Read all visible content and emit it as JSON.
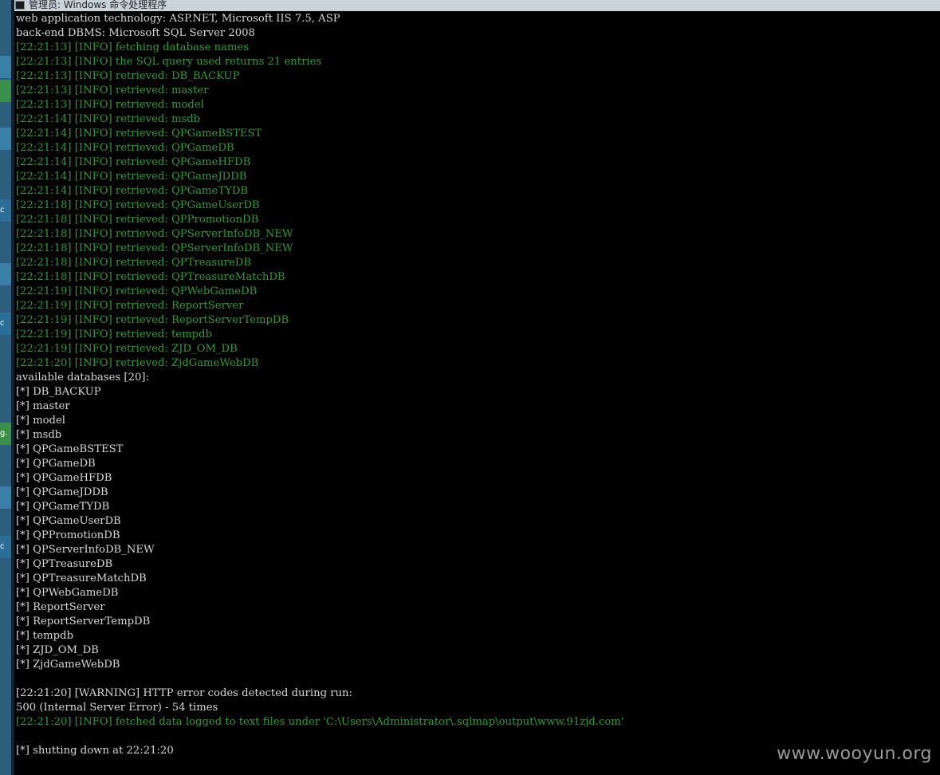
{
  "window": {
    "title": "管理员: Windows 命令处理程序",
    "icon": "cmd-icon"
  },
  "taskbar": {
    "tiles": [
      "",
      "",
      "",
      "c",
      "",
      "c",
      "g.",
      "",
      "c"
    ]
  },
  "console_lines": [
    {
      "text": "web application technology: ASP.NET, Microsoft IIS 7.5, ASP",
      "color": "white"
    },
    {
      "text": "back-end DBMS: Microsoft SQL Server 2008",
      "color": "white"
    },
    {
      "text": "[22:21:13] [INFO] fetching database names",
      "color": "green"
    },
    {
      "text": "[22:21:13] [INFO] the SQL query used returns 21 entries",
      "color": "green"
    },
    {
      "text": "[22:21:13] [INFO] retrieved: DB_BACKUP",
      "color": "green"
    },
    {
      "text": "[22:21:13] [INFO] retrieved: master",
      "color": "green"
    },
    {
      "text": "[22:21:13] [INFO] retrieved: model",
      "color": "green"
    },
    {
      "text": "[22:21:14] [INFO] retrieved: msdb",
      "color": "green"
    },
    {
      "text": "[22:21:14] [INFO] retrieved: QPGameBSTEST",
      "color": "green"
    },
    {
      "text": "[22:21:14] [INFO] retrieved: QPGameDB",
      "color": "green"
    },
    {
      "text": "[22:21:14] [INFO] retrieved: QPGameHFDB",
      "color": "green"
    },
    {
      "text": "[22:21:14] [INFO] retrieved: QPGameJDDB",
      "color": "green"
    },
    {
      "text": "[22:21:14] [INFO] retrieved: QPGameTYDB",
      "color": "green"
    },
    {
      "text": "[22:21:18] [INFO] retrieved: QPGameUserDB",
      "color": "green"
    },
    {
      "text": "[22:21:18] [INFO] retrieved: QPPromotionDB",
      "color": "green"
    },
    {
      "text": "[22:21:18] [INFO] retrieved: QPServerInfoDB_NEW",
      "color": "green"
    },
    {
      "text": "[22:21:18] [INFO] retrieved: QPServerInfoDB_NEW",
      "color": "green"
    },
    {
      "text": "[22:21:18] [INFO] retrieved: QPTreasureDB",
      "color": "green"
    },
    {
      "text": "[22:21:18] [INFO] retrieved: QPTreasureMatchDB",
      "color": "green"
    },
    {
      "text": "[22:21:19] [INFO] retrieved: QPWebGameDB",
      "color": "green"
    },
    {
      "text": "[22:21:19] [INFO] retrieved: ReportServer",
      "color": "green"
    },
    {
      "text": "[22:21:19] [INFO] retrieved: ReportServerTempDB",
      "color": "green"
    },
    {
      "text": "[22:21:19] [INFO] retrieved: tempdb",
      "color": "green"
    },
    {
      "text": "[22:21:19] [INFO] retrieved: ZJD_OM_DB",
      "color": "green"
    },
    {
      "text": "[22:21:20] [INFO] retrieved: ZjdGameWebDB",
      "color": "green"
    },
    {
      "text": "available databases [20]:",
      "color": "white"
    },
    {
      "text": "[*] DB_BACKUP",
      "color": "white"
    },
    {
      "text": "[*] master",
      "color": "white"
    },
    {
      "text": "[*] model",
      "color": "white"
    },
    {
      "text": "[*] msdb",
      "color": "white"
    },
    {
      "text": "[*] QPGameBSTEST",
      "color": "white"
    },
    {
      "text": "[*] QPGameDB",
      "color": "white"
    },
    {
      "text": "[*] QPGameHFDB",
      "color": "white"
    },
    {
      "text": "[*] QPGameJDDB",
      "color": "white"
    },
    {
      "text": "[*] QPGameTYDB",
      "color": "white"
    },
    {
      "text": "[*] QPGameUserDB",
      "color": "white"
    },
    {
      "text": "[*] QPPromotionDB",
      "color": "white"
    },
    {
      "text": "[*] QPServerInfoDB_NEW",
      "color": "white"
    },
    {
      "text": "[*] QPTreasureDB",
      "color": "white"
    },
    {
      "text": "[*] QPTreasureMatchDB",
      "color": "white"
    },
    {
      "text": "[*] QPWebGameDB",
      "color": "white"
    },
    {
      "text": "[*] ReportServer",
      "color": "white"
    },
    {
      "text": "[*] ReportServerTempDB",
      "color": "white"
    },
    {
      "text": "[*] tempdb",
      "color": "white"
    },
    {
      "text": "[*] ZJD_OM_DB",
      "color": "white"
    },
    {
      "text": "[*] ZjdGameWebDB",
      "color": "white"
    },
    {
      "text": "",
      "color": "white"
    },
    {
      "text": "[22:21:20] [WARNING] HTTP error codes detected during run:",
      "color": "white"
    },
    {
      "text": "500 (Internal Server Error) - 54 times",
      "color": "white"
    },
    {
      "text": "[22:21:20] [INFO] fetched data logged to text files under 'C:\\Users\\Administrator\\.sqlmap\\output\\www.91zjd.com'",
      "color": "green"
    },
    {
      "text": "",
      "color": "white"
    },
    {
      "text": "[*] shutting down at 22:21:20",
      "color": "white"
    }
  ],
  "watermark": "www.wooyun.org",
  "colors": {
    "background": "#000000",
    "text_white": "#d8d8d8",
    "text_green": "#2f9b3a"
  }
}
